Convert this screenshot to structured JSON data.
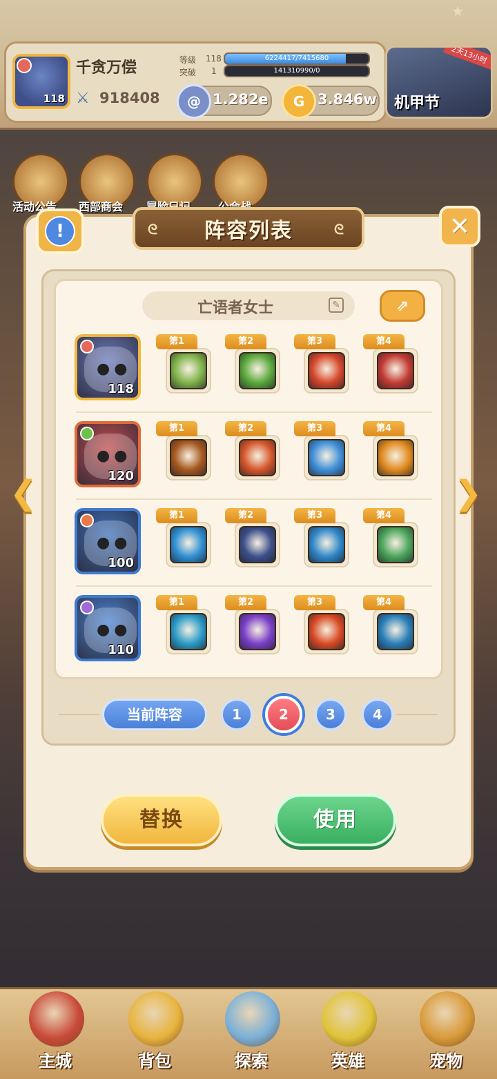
{
  "player": {
    "name": "千贪万偿",
    "level": "118",
    "power": "918408",
    "rank_label": "等级",
    "rank_value": "118",
    "rank_progress": "6224417/7415680",
    "rank_progress_fraction": 0.84,
    "break_label": "突破",
    "break_value": "1",
    "break_progress": "141310990/0",
    "break_progress_fraction": 0.0
  },
  "currencies": [
    {
      "icon": "gem-swirl-icon",
      "value": "1.282e"
    },
    {
      "icon": "gold-coin-icon",
      "value": "3.846w"
    }
  ],
  "event": {
    "name": "机甲节",
    "ribbon": "2天13小时"
  },
  "bg_menu": [
    {
      "label": "活动公告"
    },
    {
      "label": "西部商会"
    },
    {
      "label": "冒险日记"
    },
    {
      "label": "公会战"
    }
  ],
  "modal": {
    "title": "阵容列表",
    "lineup_name": "亡语者女士",
    "current_lineup_label": "当前阵容",
    "pages": [
      "1",
      "2",
      "3",
      "4"
    ],
    "active_page": "2",
    "replace_label": "替换",
    "use_label": "使用"
  },
  "heroes": [
    {
      "level": "118",
      "color": "#6a78b8",
      "border": "#f0b640",
      "elem": "#e36a5b",
      "slots": [
        {
          "tag": "第1",
          "icon": "arrow-strike-skill-icon",
          "color": "#7fb24a"
        },
        {
          "tag": "第2",
          "icon": "shield-gem-skill-icon",
          "color": "#5aa83b"
        },
        {
          "tag": "第3",
          "icon": "fire-bomb-skill-icon",
          "color": "#d5472a"
        },
        {
          "tag": "第4",
          "icon": "axe-skill-icon",
          "color": "#c23b33"
        }
      ]
    },
    {
      "level": "120",
      "color": "#c04a4a",
      "border": "#e06b3a",
      "elem": "#6cc24a",
      "slots": [
        {
          "tag": "第1",
          "icon": "eye-skill-icon",
          "color": "#a6581f"
        },
        {
          "tag": "第2",
          "icon": "campfire-skill-icon",
          "color": "#d5562a"
        },
        {
          "tag": "第3",
          "icon": "ghost-skill-icon",
          "color": "#3f8fd8"
        },
        {
          "tag": "第4",
          "icon": "flame-dragon-skill-icon",
          "color": "#e08a1f"
        }
      ]
    },
    {
      "level": "100",
      "color": "#3d6fb8",
      "border": "#3f7ad0",
      "elem": "#e87a4a",
      "slots": [
        {
          "tag": "第1",
          "icon": "leaf-orb-skill-icon",
          "color": "#2e8fd3"
        },
        {
          "tag": "第2",
          "icon": "tree-golem-skill-icon",
          "color": "#3b4f8a"
        },
        {
          "tag": "第3",
          "icon": "guardian-skill-icon",
          "color": "#2f86c8"
        },
        {
          "tag": "第4",
          "icon": "flower-skill-icon",
          "color": "#4aa35a"
        }
      ]
    },
    {
      "level": "110",
      "color": "#4a82d2",
      "border": "#3f7ad0",
      "elem": "#a06ad8",
      "slots": [
        {
          "tag": "第1",
          "icon": "whirl-spear-skill-icon",
          "color": "#2b9bc8"
        },
        {
          "tag": "第2",
          "icon": "arcane-circle-skill-icon",
          "color": "#7a3fc8"
        },
        {
          "tag": "第3",
          "icon": "fist-skill-icon",
          "color": "#d84a24"
        },
        {
          "tag": "第4",
          "icon": "mask-skill-icon",
          "color": "#2a7fb8"
        }
      ]
    }
  ],
  "bottom_nav": [
    {
      "label": "主城",
      "color": "#c94b3a"
    },
    {
      "label": "背包",
      "color": "#e7b43e"
    },
    {
      "label": "探索",
      "color": "#7ab0d8"
    },
    {
      "label": "英雄",
      "color": "#e0c43a"
    },
    {
      "label": "宠物",
      "color": "#d99a3a"
    }
  ]
}
